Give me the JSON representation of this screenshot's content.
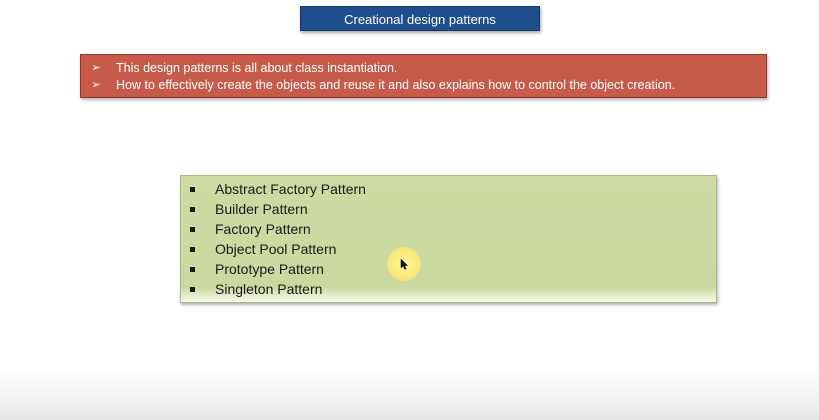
{
  "slide": {
    "title": "Creational design patterns",
    "intro": [
      {
        "arrow": "➢",
        "text": "This design patterns is all about class instantiation."
      },
      {
        "arrow": "➢",
        "text": "How to effectively create the objects and reuse it and also explains how to control the object creation."
      }
    ],
    "patterns": [
      "Abstract Factory Pattern",
      "Builder Pattern",
      "Factory Pattern",
      "Object Pool Pattern",
      "Prototype Pattern",
      "Singleton Pattern"
    ]
  },
  "colors": {
    "title_bg": "#1f4e8c",
    "intro_bg": "#c65b4b",
    "patterns_bg": "#ccdba3",
    "cursor_highlight": "#fbe97a"
  },
  "icons": {
    "cursor": "mouse-pointer-icon",
    "arrow_bullet": "arrow-bullet-icon",
    "square_bullet": "square-bullet-icon"
  }
}
